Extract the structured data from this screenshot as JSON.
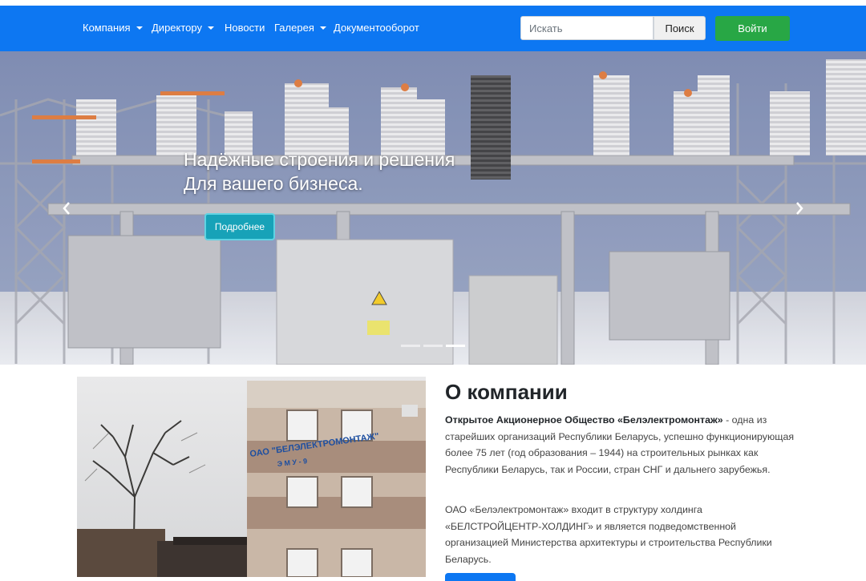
{
  "navbar": {
    "items": [
      {
        "label": "Компания",
        "dropdown": true
      },
      {
        "label": "Директору",
        "dropdown": true
      },
      {
        "label": "Новости",
        "dropdown": false
      },
      {
        "label": "Галерея",
        "dropdown": true
      },
      {
        "label": "Документооборот",
        "dropdown": false
      }
    ],
    "search_placeholder": "Искать",
    "search_button": "Поиск",
    "login_button": "Войти",
    "accent_color": "#0d77f2"
  },
  "hero": {
    "title_line1": "Надёжные строения и решения",
    "title_line2": "Для вашего бизнеса.",
    "button_label": "Подробнее",
    "slide_count": 3,
    "active_slide": 3,
    "prev_icon": "chevron-left-icon",
    "next_icon": "chevron-right-icon"
  },
  "about": {
    "title": "О компании",
    "p1_strong": "Открытое Акционерное Общество «Белэлектромонтаж»",
    "p1_rest": " - одна из старейших организаций Республики Беларусь, успешно функционирующая более 75 лет (год образования – 1944) на строительных рынках как Республики Беларусь, так и России, стран СНГ и дальнего зарубежья.",
    "p2": "ОАО «Белэлектромонтаж» входит в структуру холдинга «БЕЛСТРОЙЦЕНТР-ХОЛДИНГ» и является подведомственной организацией Министерства архитектуры и строительства Республики Беларусь.",
    "building_sign": "ОАО \"БЕЛЭЛЕКТРОМОНТАЖ\"",
    "building_sign2": "Э М У - 9"
  }
}
